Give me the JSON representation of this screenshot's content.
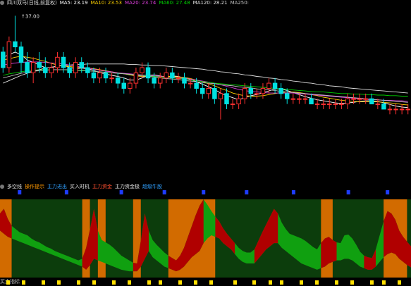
{
  "main": {
    "legend": [
      {
        "text": "四川双马(日线,前复权)",
        "color": "#e0e0e0"
      },
      {
        "text": "MA5: 23.19",
        "color": "#ffffff"
      },
      {
        "text": "MA10: 23.53",
        "color": "#ffd200"
      },
      {
        "text": "MA20: 23.74",
        "color": "#e040e0"
      },
      {
        "text": "MA60: 27.48",
        "color": "#00d000"
      },
      {
        "text": "MA120: 28.21",
        "color": "#e0e0e0"
      },
      {
        "text": "MA250:",
        "color": "#c0c0c0"
      }
    ],
    "max_label": "37.00"
  },
  "indicator": {
    "legend": [
      {
        "text": "多空线",
        "color": "#e0e0e0"
      },
      {
        "text": "操作提示",
        "color": "#ff9900"
      },
      {
        "text": "主力进出",
        "color": "#30a0ff"
      },
      {
        "text": "买入时机",
        "color": "#e0e0e0"
      },
      {
        "text": "主力资金",
        "color": "#ff5030"
      },
      {
        "text": "主力资金极",
        "color": "#e0e0e0"
      },
      {
        "text": "超级牛股",
        "color": "#30a0ff"
      }
    ]
  },
  "bottom": {
    "label": "买卖指标"
  },
  "colors": {
    "up": "#ff3030",
    "down": "#00e0e0",
    "bull": "#b00000",
    "bear": "#10a010",
    "band_orange": "#d26b00",
    "band_green": "#0c3d0c",
    "signal_blue": "#1e3cff",
    "signal_yellow": "#ffe000"
  },
  "chart_data": [
    {
      "type": "candlestick",
      "title": "四川双马(日线,前复权)",
      "ylim": [
        16,
        38
      ],
      "annotation": "37.00",
      "candles": [
        [
          30,
          31,
          26,
          27
        ],
        [
          27,
          33,
          26,
          32
        ],
        [
          32,
          37,
          30,
          31
        ],
        [
          31,
          32,
          26,
          28
        ],
        [
          28,
          30,
          25,
          26
        ],
        [
          26,
          29,
          24,
          28
        ],
        [
          28,
          30,
          26,
          27
        ],
        [
          27,
          29,
          25,
          26
        ],
        [
          26,
          28,
          25,
          27
        ],
        [
          27,
          30,
          26,
          29
        ],
        [
          29,
          30,
          26,
          27
        ],
        [
          27,
          28,
          25,
          26
        ],
        [
          26,
          29,
          25,
          28
        ],
        [
          28,
          29,
          26,
          27
        ],
        [
          27,
          28,
          25,
          26
        ],
        [
          26,
          27,
          24,
          25
        ],
        [
          25,
          27,
          24,
          26
        ],
        [
          26,
          27,
          24,
          25
        ],
        [
          25,
          26,
          24,
          25
        ],
        [
          25,
          26,
          23,
          24
        ],
        [
          24,
          25,
          22,
          23
        ],
        [
          23,
          25,
          22,
          24
        ],
        [
          24,
          27,
          23,
          26
        ],
        [
          26,
          28,
          25,
          27
        ],
        [
          27,
          28,
          24,
          25
        ],
        [
          25,
          26,
          23,
          24
        ],
        [
          24,
          26,
          23,
          25
        ],
        [
          25,
          27,
          24,
          26
        ],
        [
          26,
          27,
          24,
          25
        ],
        [
          25,
          26,
          24,
          25
        ],
        [
          25,
          26,
          23,
          24
        ],
        [
          24,
          25,
          23,
          24
        ],
        [
          24,
          25,
          22,
          23
        ],
        [
          23,
          24,
          21,
          22
        ],
        [
          22,
          24,
          21,
          23
        ],
        [
          23,
          24,
          20,
          21
        ],
        [
          21,
          23,
          17,
          22
        ],
        [
          22,
          23,
          19,
          20
        ],
        [
          20,
          21,
          19,
          20
        ],
        [
          20,
          22,
          19,
          21
        ],
        [
          21,
          24,
          20,
          23
        ],
        [
          23,
          24,
          21,
          22
        ],
        [
          22,
          23,
          21,
          22
        ],
        [
          22,
          24,
          21,
          23
        ],
        [
          23,
          25,
          22,
          24
        ],
        [
          24,
          25,
          22,
          23
        ],
        [
          23,
          24,
          21,
          22
        ],
        [
          22,
          23,
          20,
          21
        ],
        [
          21,
          22,
          20,
          21
        ],
        [
          21,
          22,
          20,
          21
        ],
        [
          21,
          22,
          20,
          21
        ],
        [
          21,
          22,
          20,
          20
        ],
        [
          20,
          21,
          19,
          20
        ],
        [
          20,
          21,
          19,
          20
        ],
        [
          20,
          21,
          19,
          20
        ],
        [
          20,
          21,
          19,
          20
        ],
        [
          20,
          21,
          19,
          20
        ],
        [
          20,
          22,
          19,
          21
        ],
        [
          21,
          22,
          20,
          21
        ],
        [
          21,
          22,
          20,
          21
        ],
        [
          21,
          22,
          20,
          21
        ],
        [
          21,
          22,
          20,
          20
        ],
        [
          20,
          21,
          19,
          20
        ],
        [
          20,
          21,
          19,
          19
        ],
        [
          19,
          20,
          18,
          19
        ],
        [
          19,
          20,
          18,
          19
        ],
        [
          19,
          20,
          18,
          19
        ],
        [
          19,
          20,
          18,
          19
        ]
      ],
      "series": [
        {
          "name": "MA5",
          "values": [
            29,
            29.5,
            30,
            29.5,
            28.5,
            28,
            27.5,
            27,
            27,
            27.3,
            27.5,
            27,
            26.8,
            26.9,
            26.8,
            26.5,
            26,
            25.8,
            25.5,
            25.3,
            25,
            24.6,
            24.6,
            25,
            25.5,
            25.6,
            25.4,
            25.2,
            25.4,
            25.3,
            25,
            24.7,
            24.3,
            23.8,
            23.3,
            22.8,
            22.1,
            21.6,
            21.2,
            20.8,
            21.2,
            21.6,
            21.8,
            22.2,
            22.5,
            22.9,
            22.9,
            22.6,
            22.2,
            21.8,
            21.4,
            21.1,
            20.8,
            20.6,
            20.4,
            20.2,
            20.1,
            20.2,
            20.3,
            20.5,
            20.6,
            20.6,
            20.5,
            20.2,
            19.9,
            19.6,
            19.4,
            19.3
          ]
        },
        {
          "name": "MA10",
          "values": [
            28.5,
            28.7,
            29,
            29.2,
            29,
            28.8,
            28.5,
            28.2,
            27.8,
            27.5,
            27.3,
            27.2,
            27.1,
            27,
            26.9,
            26.8,
            26.6,
            26.4,
            26.2,
            26,
            25.8,
            25.6,
            25.4,
            25.3,
            25.3,
            25.3,
            25.3,
            25.3,
            25.3,
            25.2,
            25.1,
            24.9,
            24.6,
            24.3,
            23.9,
            23.5,
            23,
            22.6,
            22.1,
            21.8,
            21.6,
            21.5,
            21.5,
            21.6,
            21.8,
            22,
            22.2,
            22.3,
            22.3,
            22.2,
            22,
            21.8,
            21.6,
            21.3,
            21.1,
            20.9,
            20.7,
            20.6,
            20.5,
            20.4,
            20.4,
            20.4,
            20.4,
            20.3,
            20.2,
            20.1,
            19.9,
            19.8
          ]
        },
        {
          "name": "MA20",
          "values": [
            27.5,
            27.7,
            27.9,
            28,
            28.1,
            28.1,
            28.1,
            28,
            27.9,
            27.8,
            27.7,
            27.5,
            27.3,
            27.1,
            26.9,
            26.7,
            26.5,
            26.3,
            26.2,
            26,
            25.9,
            25.8,
            25.7,
            25.6,
            25.5,
            25.4,
            25.3,
            25.2,
            25.1,
            25,
            24.9,
            24.8,
            24.6,
            24.4,
            24.2,
            24,
            23.7,
            23.4,
            23.1,
            22.8,
            22.6,
            22.4,
            22.3,
            22.2,
            22.1,
            22.1,
            22.1,
            22.1,
            22.1,
            22,
            21.9,
            21.8,
            21.7,
            21.6,
            21.5,
            21.4,
            21.3,
            21.2,
            21.1,
            21,
            20.9,
            20.8,
            20.8,
            20.7,
            20.7,
            20.6,
            20.6,
            20.5
          ]
        },
        {
          "name": "MA60",
          "values": [
            25.5,
            25.8,
            26,
            26.2,
            26.4,
            26.5,
            26.6,
            26.6,
            26.6,
            26.6,
            26.6,
            26.5,
            26.5,
            26.4,
            26.4,
            26.3,
            26.2,
            26.1,
            26,
            25.9,
            25.8,
            25.7,
            25.6,
            25.5,
            25.4,
            25.3,
            25.2,
            25.1,
            25,
            24.9,
            24.8,
            24.6,
            24.5,
            24.3,
            24.2,
            24,
            23.9,
            23.8,
            23.7,
            23.6,
            23.5,
            23.4,
            23.3,
            23.2,
            23.1,
            23,
            22.9,
            22.8,
            22.7,
            22.6,
            22.5,
            22.4,
            22.3,
            22.3,
            22.2,
            22.1,
            22,
            22,
            21.9,
            21.9,
            21.8,
            21.8,
            21.7,
            21.7,
            21.6,
            21.6,
            21.5,
            21.5
          ]
        },
        {
          "name": "MA120",
          "values": [
            24,
            24.5,
            25,
            25.5,
            25.9,
            26.3,
            26.6,
            26.9,
            27.1,
            27.3,
            27.4,
            27.5,
            27.6,
            27.6,
            27.7,
            27.7,
            27.7,
            27.7,
            27.7,
            27.7,
            27.7,
            27.6,
            27.6,
            27.5,
            27.5,
            27.4,
            27.4,
            27.3,
            27.2,
            27.1,
            27,
            26.9,
            26.8,
            26.7,
            26.5,
            26.4,
            26.2,
            26.1,
            25.9,
            25.8,
            25.6,
            25.5,
            25.3,
            25.2,
            25,
            24.9,
            24.7,
            24.6,
            24.4,
            24.3,
            24.1,
            24,
            23.8,
            23.7,
            23.5,
            23.4,
            23.3,
            23.1,
            23,
            22.9,
            22.8,
            22.7,
            22.6,
            22.5,
            22.4,
            22.3,
            22.2,
            22.1
          ]
        },
        {
          "name": "MA250",
          "values": [
            25,
            25.3,
            25.6,
            25.9,
            26.1,
            26.3,
            26.4,
            26.5,
            26.6,
            26.6,
            26.6,
            26.6,
            26.5,
            26.5,
            26.4,
            26.3,
            26.2,
            26.1,
            26,
            25.9,
            25.8,
            25.7,
            25.5,
            25.4,
            25.3,
            25.2,
            25,
            24.9,
            24.8,
            24.7,
            24.5,
            24.4,
            24.3,
            24.1,
            24,
            23.9,
            23.7,
            23.6,
            23.5,
            23.3,
            23.2,
            23.1,
            22.9,
            22.8,
            22.7,
            22.6,
            22.4,
            22.3,
            22.2,
            22.1,
            22,
            21.9,
            21.8,
            21.7,
            21.6,
            21.5,
            21.4,
            21.3,
            21.2,
            21.1,
            21,
            20.9,
            20.8,
            20.7,
            20.6,
            20.5,
            20.4,
            20.3
          ]
        }
      ]
    },
    {
      "type": "area",
      "ylim": [
        0,
        100
      ],
      "bands": [
        {
          "from": 0,
          "to": 3,
          "zone": "orange"
        },
        {
          "from": 3,
          "to": 21,
          "zone": "green"
        },
        {
          "from": 21,
          "to": 23,
          "zone": "orange"
        },
        {
          "from": 23,
          "to": 25,
          "zone": "green"
        },
        {
          "from": 25,
          "to": 27,
          "zone": "orange"
        },
        {
          "from": 27,
          "to": 34,
          "zone": "green"
        },
        {
          "from": 34,
          "to": 36,
          "zone": "orange"
        },
        {
          "from": 36,
          "to": 43,
          "zone": "green"
        },
        {
          "from": 43,
          "to": 55,
          "zone": "orange"
        },
        {
          "from": 55,
          "to": 82,
          "zone": "green"
        },
        {
          "from": 82,
          "to": 85,
          "zone": "orange"
        },
        {
          "from": 85,
          "to": 98,
          "zone": "green"
        },
        {
          "from": 98,
          "to": 104,
          "zone": "orange"
        },
        {
          "from": 104,
          "to": 106,
          "zone": "green"
        }
      ],
      "upper": [
        82,
        88,
        75,
        66,
        62,
        58,
        56,
        54,
        50,
        47,
        45,
        42,
        39,
        37,
        34,
        32,
        30,
        28,
        26,
        24,
        22,
        24,
        38,
        62,
        88,
        60,
        48,
        45,
        42,
        38,
        33,
        28,
        25,
        22,
        19,
        18,
        48,
        82,
        60,
        48,
        42,
        37,
        32,
        28,
        25,
        22,
        28,
        38,
        52,
        66,
        80,
        92,
        100,
        93,
        85,
        78,
        72,
        63,
        56,
        50,
        44,
        38,
        34,
        32,
        32,
        36,
        47,
        58,
        68,
        78,
        88,
        82,
        70,
        62,
        56,
        54,
        52,
        50,
        47,
        43,
        39,
        36,
        44,
        50,
        52,
        48,
        45,
        44,
        54,
        55,
        50,
        42,
        33,
        28,
        26,
        25,
        36,
        54,
        72,
        85,
        82,
        74,
        60,
        52,
        46,
        40
      ],
      "lower": [
        60,
        56,
        52,
        50,
        48,
        46,
        44,
        42,
        40,
        38,
        36,
        34,
        32,
        30,
        28,
        26,
        24,
        22,
        20,
        18,
        16,
        14,
        10,
        16,
        24,
        22,
        20,
        18,
        16,
        14,
        12,
        10,
        9,
        8,
        8,
        8,
        14,
        24,
        34,
        26,
        22,
        18,
        14,
        12,
        10,
        8,
        10,
        14,
        20,
        26,
        30,
        34,
        44,
        50,
        54,
        52,
        50,
        44,
        40,
        36,
        30,
        24,
        20,
        18,
        18,
        18,
        24,
        30,
        36,
        40,
        44,
        44,
        38,
        34,
        30,
        26,
        22,
        18,
        16,
        14,
        12,
        10,
        12,
        14,
        18,
        20,
        22,
        22,
        24,
        24,
        22,
        18,
        14,
        12,
        10,
        10,
        14,
        20,
        26,
        30,
        32,
        30,
        24,
        20,
        16,
        13
      ],
      "bull_segments": [
        [
          0,
          3
        ],
        [
          21,
          25
        ],
        [
          34,
          38
        ],
        [
          43,
          52
        ],
        [
          55,
          60
        ],
        [
          65,
          71
        ],
        [
          82,
          86
        ],
        [
          93,
          96
        ],
        [
          98,
          106
        ]
      ],
      "signals_blue": [
        5,
        17,
        31,
        42,
        52,
        63,
        75,
        89,
        99
      ],
      "signals_yellow": [
        2,
        6,
        11,
        15,
        20,
        24,
        29,
        33,
        38,
        41,
        46,
        50,
        54,
        60,
        65,
        69,
        72,
        77,
        81,
        86,
        90,
        95,
        98,
        102
      ]
    }
  ]
}
